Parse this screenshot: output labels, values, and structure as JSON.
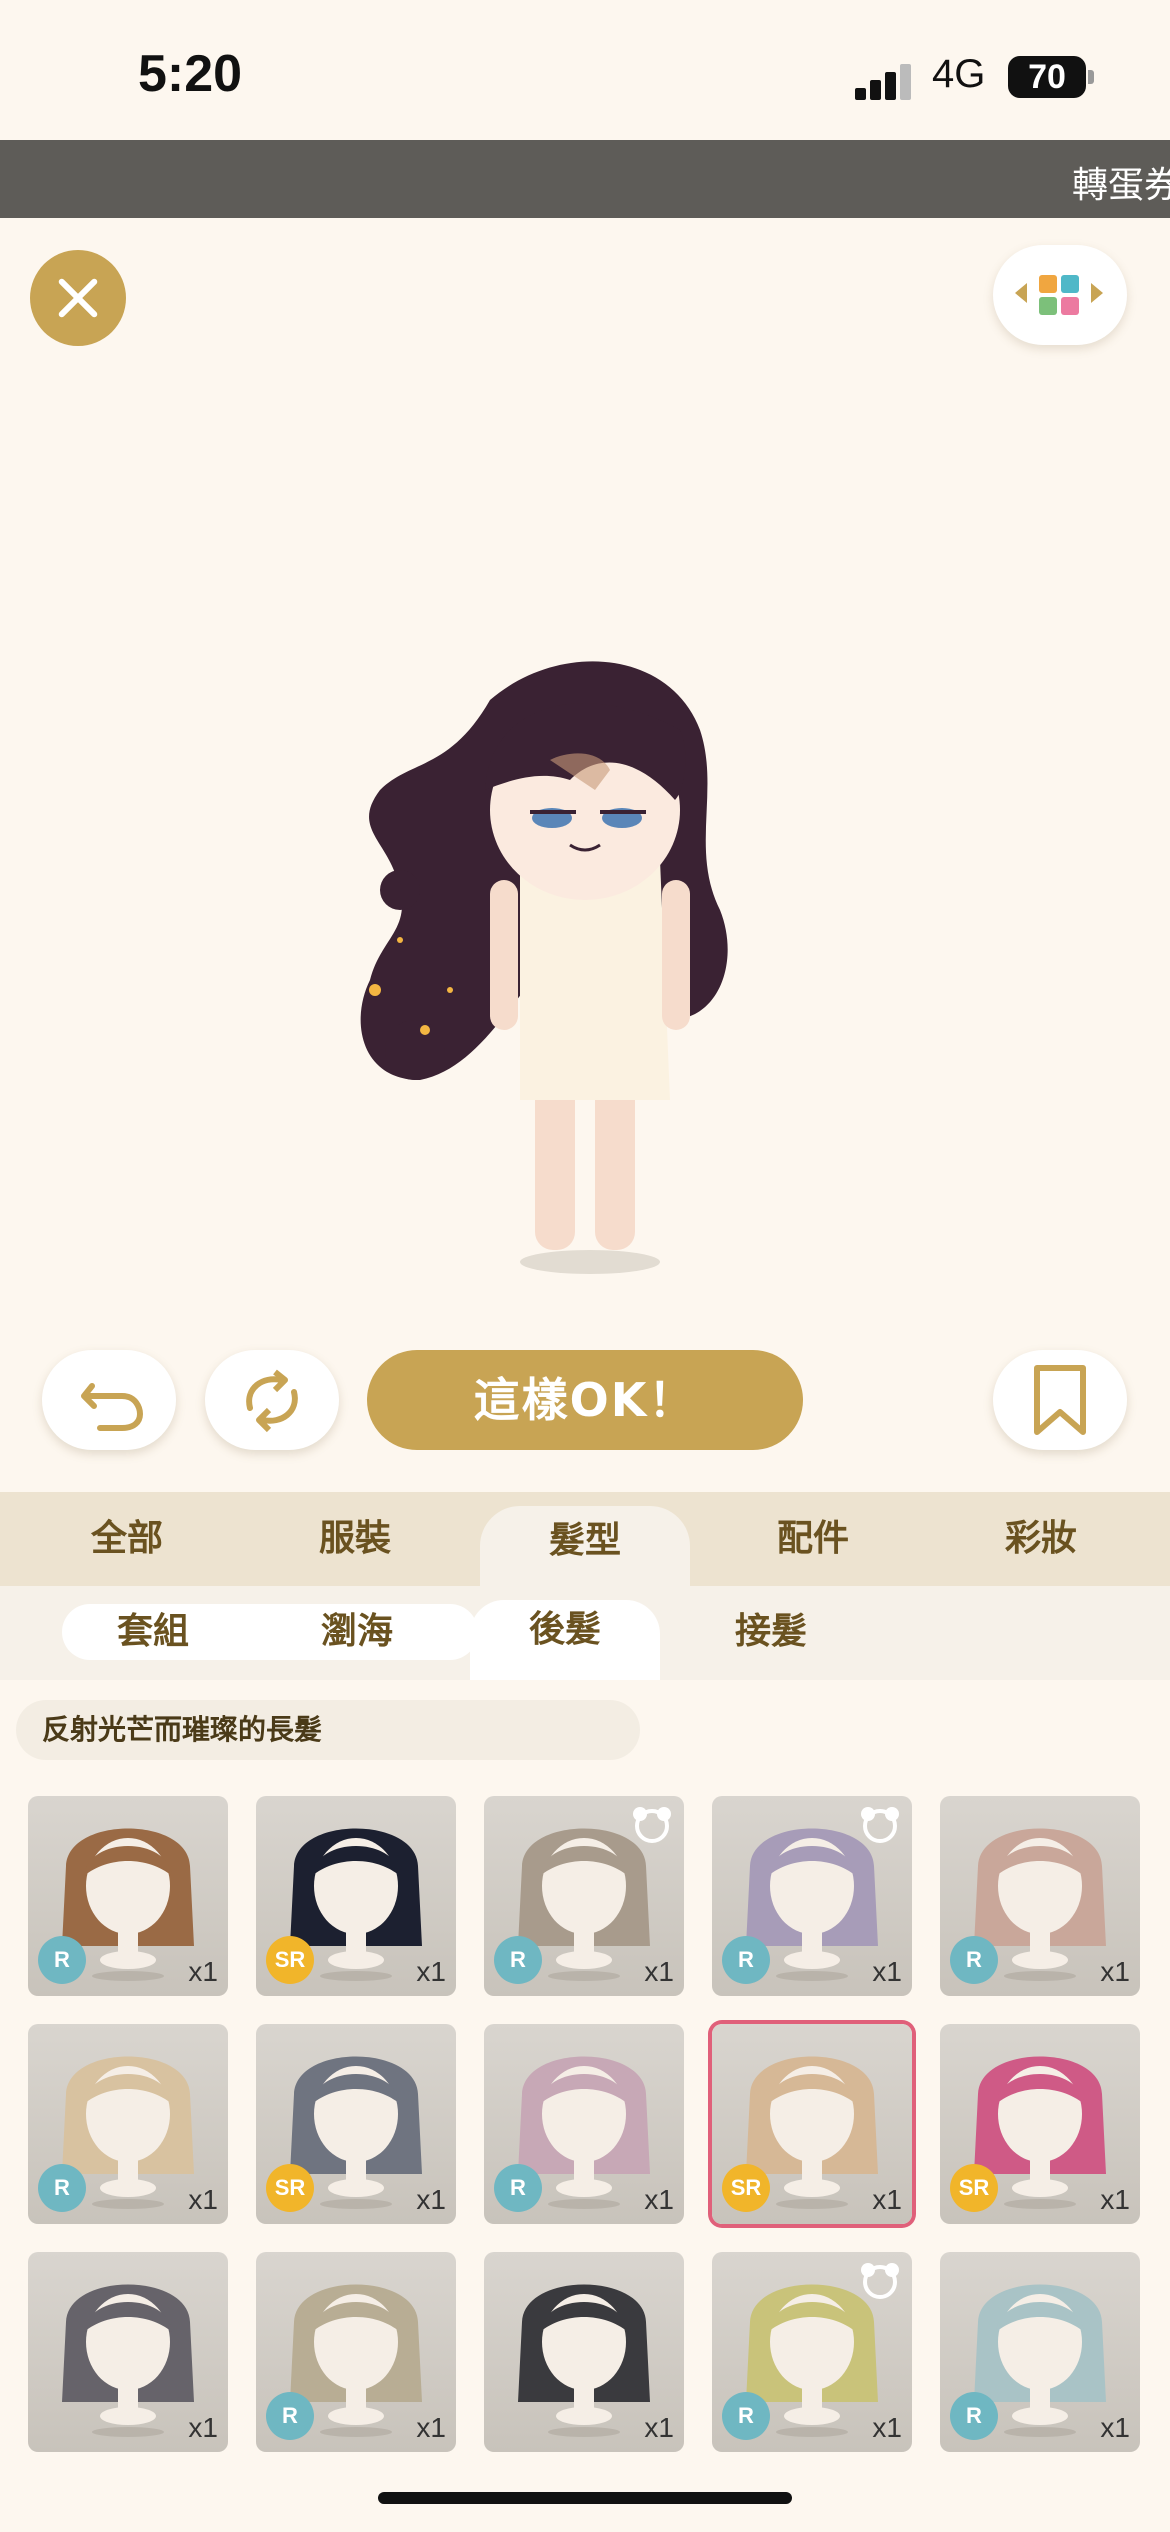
{
  "status_bar": {
    "time": "5:20",
    "network": "4G",
    "battery": "70"
  },
  "ticker": {
    "text": "轉蛋券"
  },
  "actions": {
    "ok_label": "這樣OK！"
  },
  "category_tabs": [
    "全部",
    "服裝",
    "髮型",
    "配件",
    "彩妝"
  ],
  "active_category": "髮型",
  "sub_tabs": [
    "套組",
    "瀏海",
    "後髮",
    "接髮"
  ],
  "active_sub_tab": "後髮",
  "item_name": "反射光芒而璀璨的長髮",
  "items": [
    {
      "rarity": "R",
      "qty": "x1",
      "hair": "#9a6a45",
      "bear": false
    },
    {
      "rarity": "SR",
      "qty": "x1",
      "hair": "#1c2030",
      "bear": false
    },
    {
      "rarity": "R",
      "qty": "x1",
      "hair": "#a89b8c",
      "bear": true
    },
    {
      "rarity": "R",
      "qty": "x1",
      "hair": "#a79cb8",
      "bear": true
    },
    {
      "rarity": "R",
      "qty": "x1",
      "hair": "#c9a79a",
      "bear": false
    },
    {
      "rarity": "R",
      "qty": "x1",
      "hair": "#d8c2a0",
      "bear": false
    },
    {
      "rarity": "SR",
      "qty": "x1",
      "hair": "#6f7480",
      "bear": false
    },
    {
      "rarity": "R",
      "qty": "x1",
      "hair": "#c7a8b6",
      "bear": false
    },
    {
      "rarity": "SR",
      "qty": "x1",
      "hair": "#d6b896",
      "bear": false,
      "selected": true
    },
    {
      "rarity": "SR",
      "qty": "x1",
      "hair": "#cf5a86",
      "bear": false
    },
    {
      "rarity": "",
      "qty": "x1",
      "hair": "#66636a",
      "bear": false
    },
    {
      "rarity": "R",
      "qty": "x1",
      "hair": "#b8ad94",
      "bear": false
    },
    {
      "rarity": "",
      "qty": "x1",
      "hair": "#3a3a3e",
      "bear": false
    },
    {
      "rarity": "R",
      "qty": "x1",
      "hair": "#c9c37a",
      "bear": true
    },
    {
      "rarity": "R",
      "qty": "x1",
      "hair": "#a9c3c6",
      "bear": false
    }
  ],
  "colors": {
    "accent": "#c8a454",
    "tab_text": "#6a5220",
    "selected_border": "#e0607a"
  }
}
